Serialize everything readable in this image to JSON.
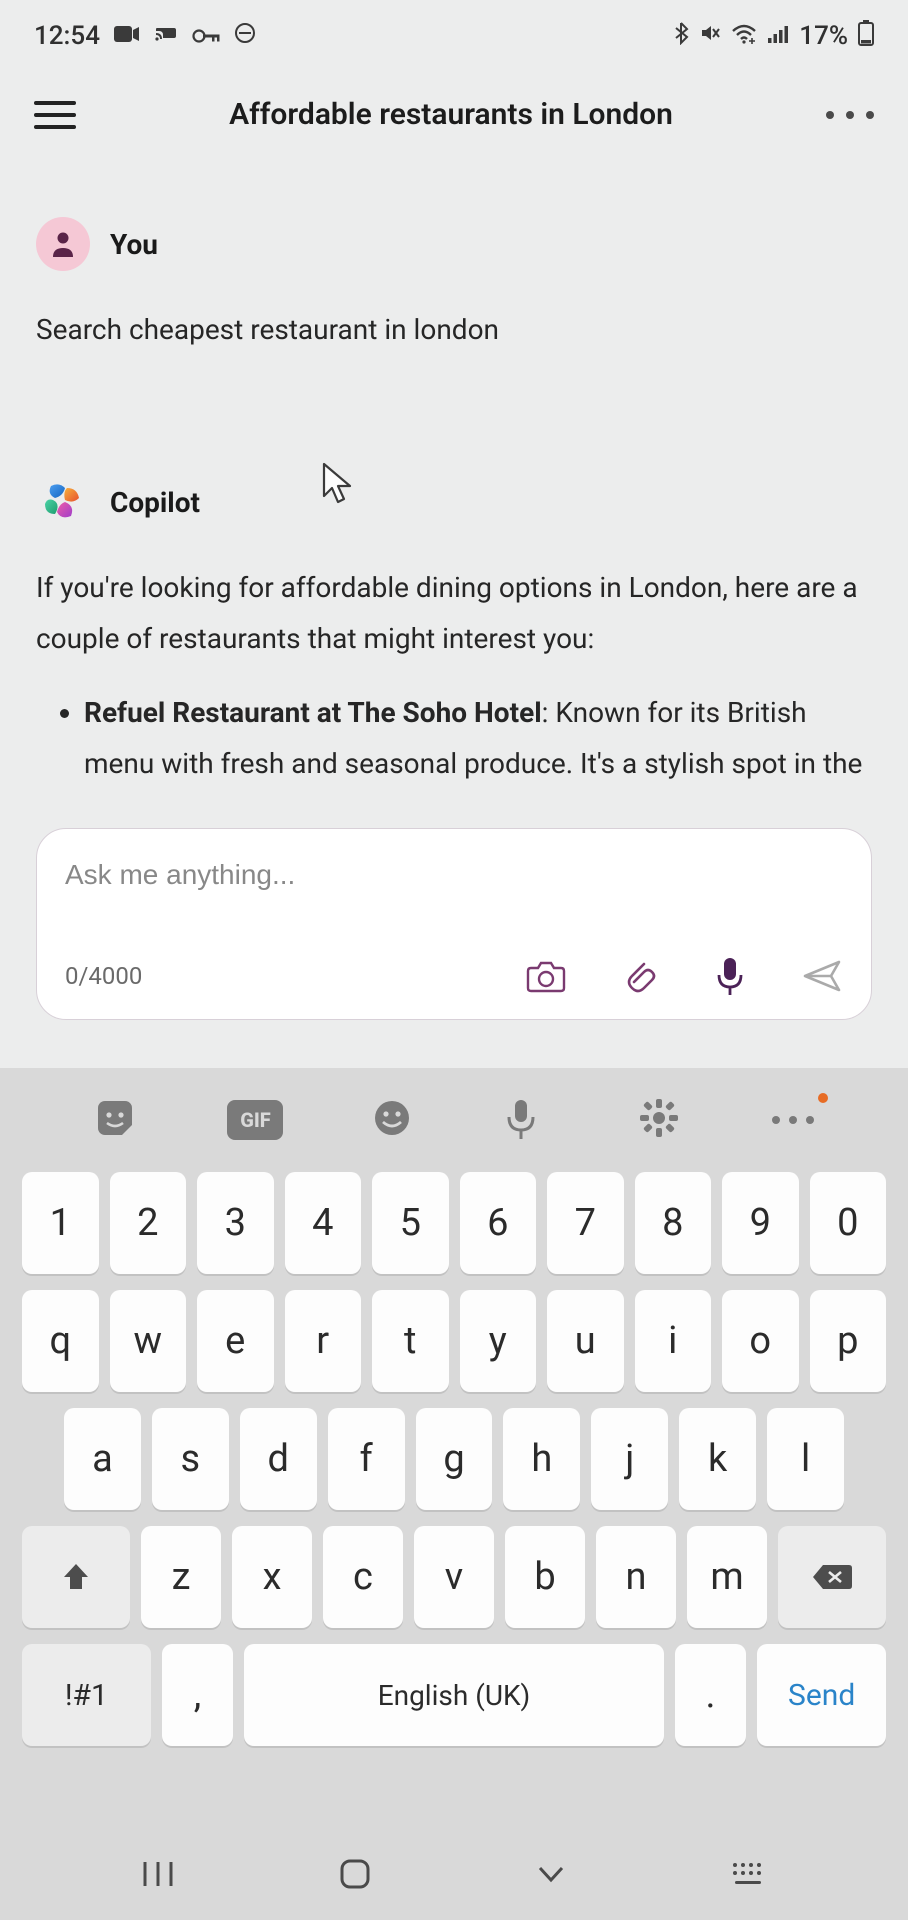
{
  "status": {
    "time": "12:54",
    "battery": "17%"
  },
  "header": {
    "title": "Affordable restaurants in London"
  },
  "chat": {
    "you": {
      "sender": "You",
      "text": "Search cheapest restaurant in london"
    },
    "copilot": {
      "sender": "Copilot",
      "intro": "If you're looking for affordable dining options in London, here are a couple of restaurants that might interest you:",
      "item_name": "Refuel Restaurant at The Soho Hotel",
      "item_desc": ": Known for its British menu with fresh and seasonal produce. It's a stylish spot in the"
    }
  },
  "input": {
    "placeholder": "Ask me anything...",
    "counter": "0/4000"
  },
  "keyboard": {
    "row1": [
      "1",
      "2",
      "3",
      "4",
      "5",
      "6",
      "7",
      "8",
      "9",
      "0"
    ],
    "row2": [
      "q",
      "w",
      "e",
      "r",
      "t",
      "y",
      "u",
      "i",
      "o",
      "p"
    ],
    "row3": [
      "a",
      "s",
      "d",
      "f",
      "g",
      "h",
      "j",
      "k",
      "l"
    ],
    "row4": [
      "z",
      "x",
      "c",
      "v",
      "b",
      "n",
      "m"
    ],
    "sym": "!#1",
    "comma": ",",
    "space": "English (UK)",
    "period": ".",
    "send": "Send",
    "gif": "GIF"
  }
}
